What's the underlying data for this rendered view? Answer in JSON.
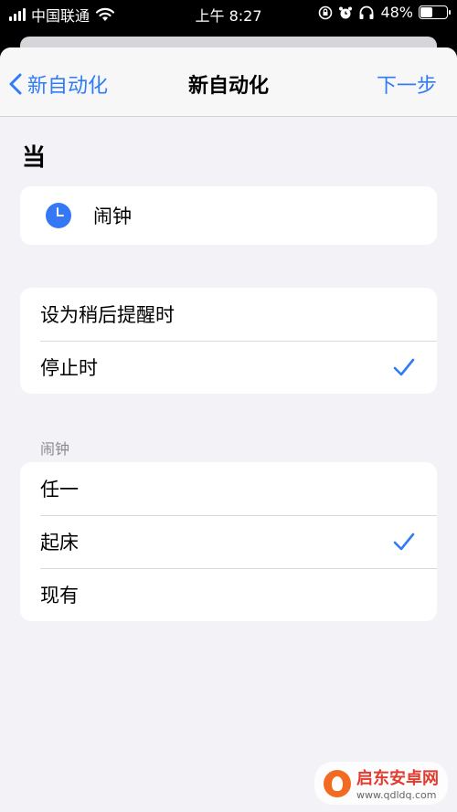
{
  "status_bar": {
    "carrier": "中国联通",
    "time": "上午 8:27",
    "battery_percent": "48%",
    "battery_level": 48
  },
  "nav": {
    "back_label": "新自动化",
    "title": "新自动化",
    "next_label": "下一步"
  },
  "section": {
    "title": "当"
  },
  "trigger": {
    "label": "闹钟",
    "icon": "clock-icon"
  },
  "options": [
    {
      "label": "设为稍后提醒时",
      "checked": false
    },
    {
      "label": "停止时",
      "checked": true
    }
  ],
  "alarm_group": {
    "label": "闹钟",
    "items": [
      {
        "label": "任一",
        "checked": false
      },
      {
        "label": "起床",
        "checked": true
      },
      {
        "label": "现有",
        "checked": false
      }
    ]
  },
  "watermark": {
    "title": "启东安卓网",
    "url": "www.qdldq.com"
  },
  "colors": {
    "accent": "#2f7cf6",
    "background": "#f2f2f7"
  }
}
